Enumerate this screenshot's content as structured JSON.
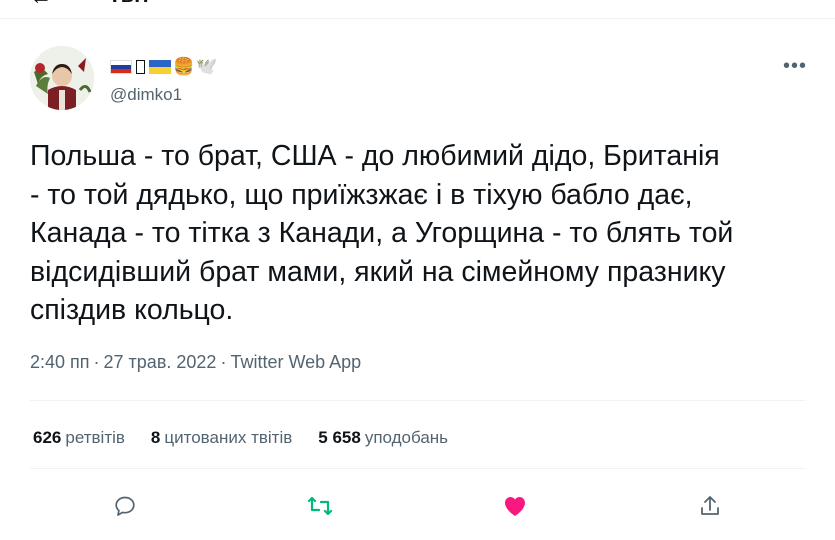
{
  "header": {
    "back_icon": "back-arrow-icon",
    "title": "Твіт"
  },
  "author": {
    "display_name_emojis": [
      "ru-flag",
      "box",
      "ua-flag",
      "🍔",
      "🕊️"
    ],
    "handle": "@dimko1"
  },
  "tweet": {
    "text": "Польша - то брат, США - до любимий дідо, Британія\n- то той дядько, що приїжзжає і в тіхую бабло дає,\nКанада - то тітка з Канади, а Угорщина - то блять той\nвідсидівший брат мами, який на сімейному празнику\nспіздив кольцо.",
    "time": "2:40 пп",
    "date": "27 трав. 2022",
    "source": "Twitter Web App"
  },
  "stats": {
    "retweets_count": "626",
    "retweets_label": "ретвітів",
    "quotes_count": "8",
    "quotes_label": "цитованих твітів",
    "likes_count": "5 658",
    "likes_label": "уподобань"
  },
  "colors": {
    "retweet": "#00ba7c",
    "like": "#f91880",
    "muted": "#536471"
  }
}
